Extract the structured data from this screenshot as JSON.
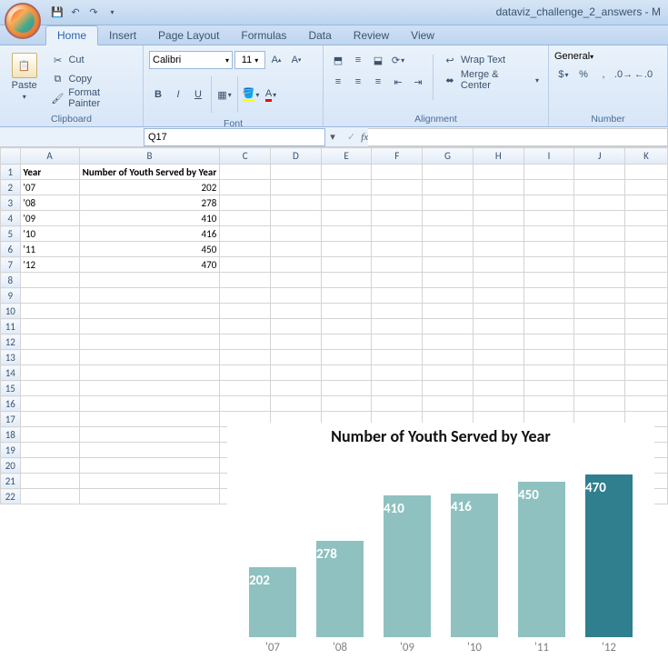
{
  "titlebar": {
    "filename": "dataviz_challenge_2_answers - M"
  },
  "tabs": {
    "home": "Home",
    "insert": "Insert",
    "pagelayout": "Page Layout",
    "formulas": "Formulas",
    "data": "Data",
    "review": "Review",
    "view": "View"
  },
  "ribbon": {
    "clipboard": {
      "paste": "Paste",
      "cut": "Cut",
      "copy": "Copy",
      "formatpainter": "Format Painter",
      "label": "Clipboard"
    },
    "font": {
      "name": "Calibri",
      "size": "11",
      "label": "Font"
    },
    "alignment": {
      "wraptext": "Wrap Text",
      "merge": "Merge & Center",
      "label": "Alignment"
    },
    "number": {
      "format": "General",
      "label": "Number"
    }
  },
  "formula_bar": {
    "cellref": "Q17",
    "fx_symbol": "fx"
  },
  "sheet": {
    "cols": [
      "A",
      "B",
      "C",
      "D",
      "E",
      "F",
      "G",
      "H",
      "I",
      "J",
      "K"
    ],
    "header_a": "Year",
    "header_b": "Number of Youth Served by Year",
    "rows": [
      {
        "year": "'07",
        "val": "202"
      },
      {
        "year": "'08",
        "val": "278"
      },
      {
        "year": "'09",
        "val": "410"
      },
      {
        "year": "'10",
        "val": "416"
      },
      {
        "year": "'11",
        "val": "450"
      },
      {
        "year": "'12",
        "val": "470"
      }
    ]
  },
  "chart_data": {
    "type": "bar",
    "title": "Number of Youth Served by Year",
    "categories": [
      "'07",
      "'08",
      "'09",
      "'10",
      "'11",
      "'12"
    ],
    "values": [
      202,
      278,
      410,
      416,
      450,
      470
    ],
    "highlight_index": 5,
    "xlabel": "",
    "ylabel": "",
    "ylim": [
      0,
      500
    ],
    "colors": {
      "default": "#8ec1c0",
      "highlight": "#2f7f8e"
    }
  }
}
